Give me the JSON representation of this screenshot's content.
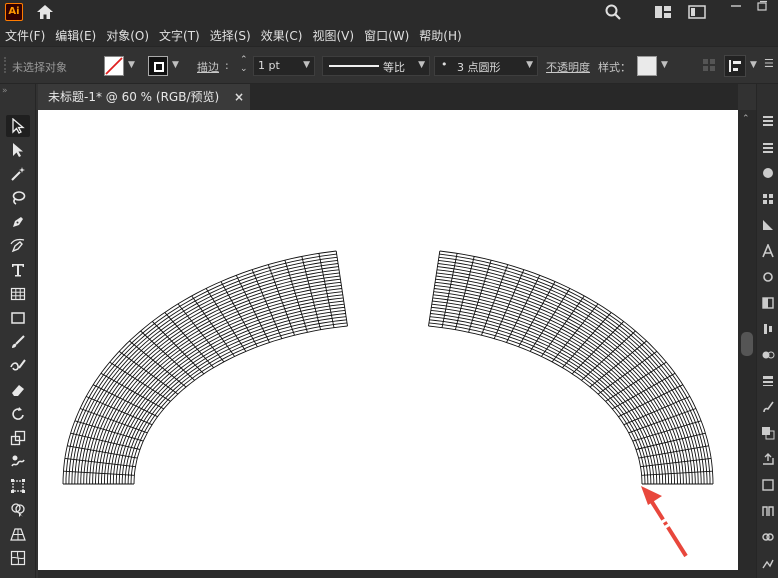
{
  "app": {
    "logo_text": "Ai"
  },
  "menu": [
    "文件(F)",
    "编辑(E)",
    "对象(O)",
    "文字(T)",
    "选择(S)",
    "效果(C)",
    "视图(V)",
    "窗口(W)",
    "帮助(H)"
  ],
  "control_bar": {
    "selection_status": "未选择对象",
    "stroke_label": "描边",
    "stroke_weight": "1 pt",
    "profile_label": "等比",
    "brush_label": "3 点圆形",
    "opacity_label": "不透明度",
    "style_label": "样式："
  },
  "document_tab": {
    "title": "未标题-1* @ 60 % (RGB/预览)",
    "close": "×"
  },
  "colors": {
    "accent_arrow": "#e8473c",
    "canvas": "#ffffff",
    "ui_bg": "#323232"
  },
  "icons": {
    "titlebar": [
      "home-icon",
      "search-icon",
      "workspace-icon",
      "arrange-documents-icon",
      "minimize-icon",
      "restore-icon"
    ],
    "tools": [
      "selection-tool-icon",
      "direct-selection-tool-icon",
      "magic-wand-tool-icon",
      "lasso-tool-icon",
      "pen-tool-icon",
      "curvature-tool-icon",
      "type-tool-icon",
      "grid-tool-icon",
      "rectangle-tool-icon",
      "paintbrush-tool-icon",
      "shaper-tool-icon",
      "eraser-tool-icon",
      "rotate-tool-icon",
      "scale-tool-icon",
      "warp-tool-icon",
      "free-transform-tool-icon",
      "shape-builder-tool-icon",
      "perspective-grid-tool-icon",
      "mesh-tool-icon"
    ]
  }
}
